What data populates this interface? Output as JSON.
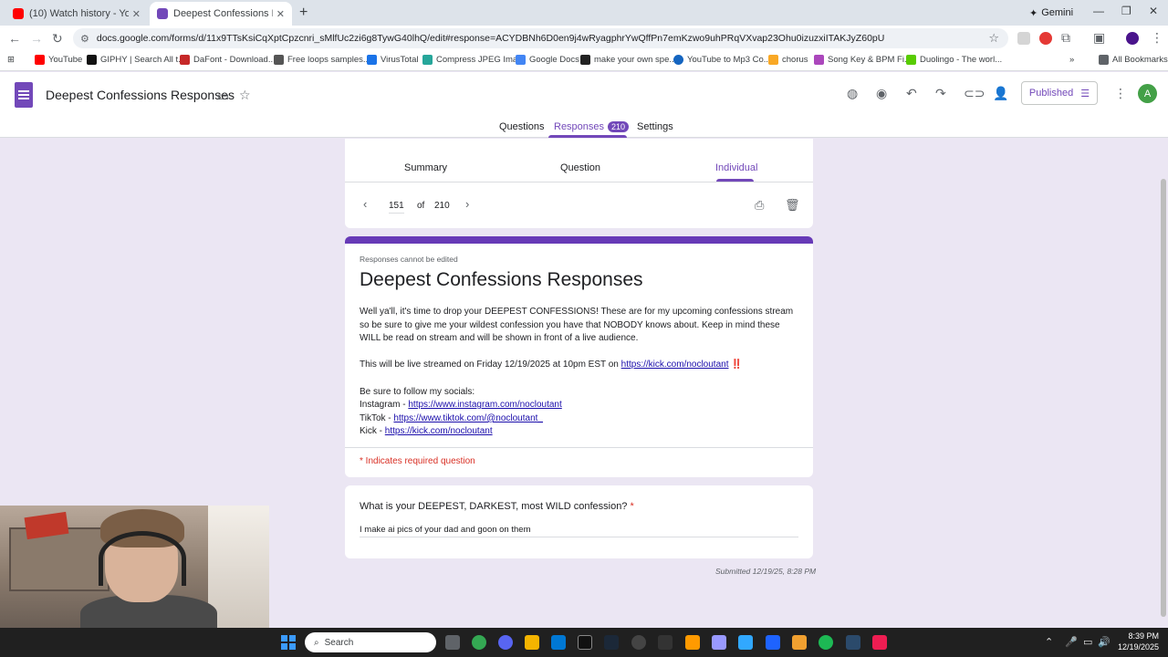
{
  "browser": {
    "tabs": [
      {
        "title": "(10) Watch history - YouTube",
        "icon": "youtube-icon",
        "color": "#ff0000"
      },
      {
        "title": "Deepest Confessions Respons",
        "icon": "google-forms-icon",
        "color": "#7248b9"
      }
    ],
    "new_tab": "+",
    "gemini_label": "Gemini",
    "url": "docs.google.com/forms/d/11x9TTsKsiCqXptCpzcnri_sMlfUc2zi6g8TywG40lhQ/edit#response=ACYDBNh6D0en9j4wRyagphrYwQffPn7emKzwo9uhPRqVXvap23Ohu0izuzxiITAKJyZ60pU",
    "bookmarks": [
      {
        "label": "YouTube",
        "color": "#ff0000"
      },
      {
        "label": "GIPHY | Search All t...",
        "color": "#111111"
      },
      {
        "label": "DaFont - Download...",
        "color": "#c62828"
      },
      {
        "label": "Free loops samples...",
        "color": "#555555"
      },
      {
        "label": "VirusTotal",
        "color": "#1a73e8"
      },
      {
        "label": "Compress JPEG Ima...",
        "color": "#26a69a"
      },
      {
        "label": "Google Docs",
        "color": "#4285f4"
      },
      {
        "label": "make your own spe...",
        "color": "#222222"
      },
      {
        "label": "YouTube to Mp3 Co...",
        "color": "#1565c0"
      },
      {
        "label": "chorus",
        "color": "#f9a825"
      },
      {
        "label": "Song Key & BPM Fi...",
        "color": "#ab47bc"
      },
      {
        "label": "Duolingo - The worl...",
        "color": "#58cc02"
      }
    ],
    "all_bookmarks": "All Bookmarks"
  },
  "form_header": {
    "title": "Deepest Confessions Responses",
    "published_label": "Published",
    "avatar_letter": "A",
    "tabs": {
      "questions": "Questions",
      "responses": "Responses",
      "responses_count": "210",
      "settings": "Settings"
    }
  },
  "responses": {
    "subtabs": {
      "summary": "Summary",
      "question": "Question",
      "individual": "Individual"
    },
    "pager": {
      "current": "151",
      "of_label": "of",
      "total": "210"
    }
  },
  "form": {
    "note": "Responses cannot be edited",
    "title": "Deepest Confessions Responses",
    "description_p1": "Well ya'll, it's time to drop your DEEPEST CONFESSIONS! These are for my upcoming confessions stream so be sure to give me your wildest confession you have that NOBODY knows about. Keep in mind these WILL be read on stream and will be shown in front of a live audience.",
    "live_prefix": "This will be live streamed on Friday 12/19/2025 at 10pm EST on ",
    "live_link": "https://kick.com/nocloutant",
    "live_suffix": "‼️",
    "follow_line": "Be sure to follow my socials:",
    "socials": [
      {
        "label": "Instagram - ",
        "link": "https://www.instagram.com/nocloutant"
      },
      {
        "label": "TikTok - ",
        "link": "https://www.tiktok.com/@nocloutant_"
      },
      {
        "label": "Kick - ",
        "link": "https://kick.com/nocloutant"
      }
    ],
    "required_note": "* Indicates required question"
  },
  "question": {
    "text": "What is your DEEPEST, DARKEST, most WILD confession?",
    "required_mark": "*",
    "answer": "I make ai pics of your dad and goon on them"
  },
  "submitted": "Submitted 12/19/25, 8:28 PM",
  "taskbar": {
    "search_placeholder": "Search",
    "time": "8:39 PM",
    "date": "12/19/2025"
  },
  "colors": {
    "accent": "#7248b9",
    "header_bar": "#673ab7",
    "required": "#d93025",
    "link": "#1a0dab",
    "page_bg": "#ebe6f3"
  }
}
